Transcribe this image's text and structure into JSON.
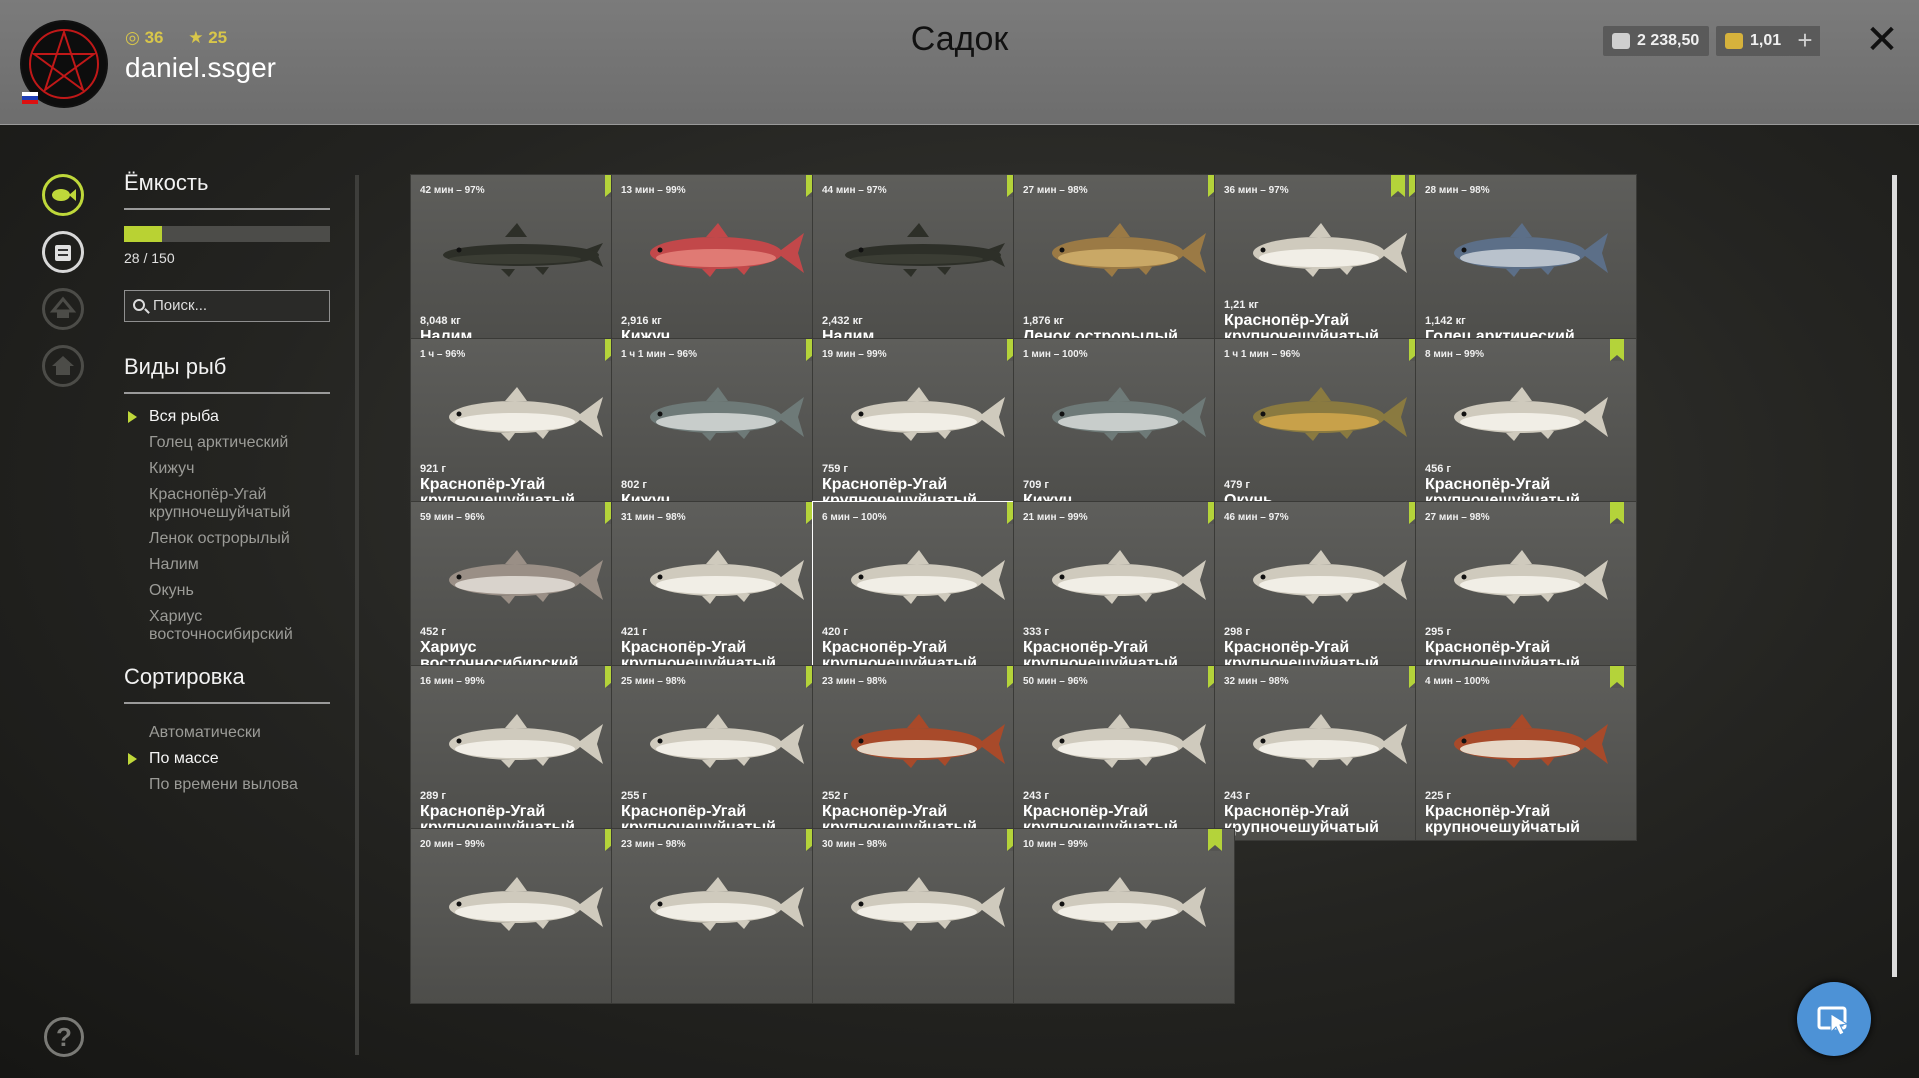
{
  "header": {
    "title": "Садок",
    "username": "daniel.ssger",
    "level": "36",
    "rank": "25",
    "silver": "2 238,50",
    "gold": "1,01",
    "add_label": "+",
    "close_label": "✕"
  },
  "capacity": {
    "title": "Ёмкость",
    "count": "28 / 150",
    "fill_fraction": 0.1867
  },
  "search": {
    "placeholder": "Поиск..."
  },
  "species": {
    "title": "Виды рыб",
    "items": [
      {
        "label": "Вся рыба",
        "selected": true
      },
      {
        "label": "Голец арктический"
      },
      {
        "label": "Кижуч"
      },
      {
        "label": "Краснопёр-Угай крупночешуйчатый"
      },
      {
        "label": "Ленок острорылый"
      },
      {
        "label": "Налим"
      },
      {
        "label": "Окунь"
      },
      {
        "label": "Хариус восточносибирский"
      }
    ]
  },
  "sorting": {
    "title": "Сортировка",
    "items": [
      {
        "label": "Автоматически"
      },
      {
        "label": "По массе",
        "selected": true
      },
      {
        "label": "По времени вылова"
      }
    ]
  },
  "help_label": "?",
  "fish": [
    {
      "time": "42 мин – 97%",
      "weight": "8,048 кг",
      "name": "Налим",
      "kind": "burbot",
      "tags": 1
    },
    {
      "time": "13 мин – 99%",
      "weight": "2,916 кг",
      "name": "Кижуч",
      "kind": "coho_red",
      "tags": 1
    },
    {
      "time": "44 мин – 97%",
      "weight": "2,432 кг",
      "name": "Налим",
      "kind": "burbot",
      "tags": 1
    },
    {
      "time": "27 мин – 98%",
      "weight": "1,876 кг",
      "name": "Ленок острорылый",
      "kind": "lenok",
      "tags": 1
    },
    {
      "time": "36 мин – 97%",
      "weight": "1,21 кг",
      "name": "Краснопёр-Угай крупночешуйчатый",
      "kind": "ugai",
      "tags": 2
    },
    {
      "time": "28 мин – 98%",
      "weight": "1,142 кг",
      "name": "Голец арктический",
      "kind": "char",
      "tags": 0
    },
    {
      "time": "1 ч – 96%",
      "weight": "921 г",
      "name": "Краснопёр-Угай крупночешуйчатый",
      "kind": "ugai",
      "tags": 1
    },
    {
      "time": "1 ч 1 мин – 96%",
      "weight": "802 г",
      "name": "Кижуч",
      "kind": "coho",
      "tags": 1
    },
    {
      "time": "19 мин – 99%",
      "weight": "759 г",
      "name": "Краснопёр-Угай крупночешуйчатый",
      "kind": "ugai",
      "tags": 1
    },
    {
      "time": "1 мин – 100%",
      "weight": "709 г",
      "name": "Кижуч",
      "kind": "coho",
      "tags": 0
    },
    {
      "time": "1 ч 1 мин – 96%",
      "weight": "479 г",
      "name": "Окунь",
      "kind": "perch",
      "tags": 1
    },
    {
      "time": "8 мин – 99%",
      "weight": "456 г",
      "name": "Краснопёр-Угай крупночешуйчатый",
      "kind": "ugai",
      "tags": 1
    },
    {
      "time": "59 мин – 96%",
      "weight": "452 г",
      "name": "Хариус восточносибирский",
      "kind": "grayling",
      "tags": 1
    },
    {
      "time": "31 мин – 98%",
      "weight": "421 г",
      "name": "Краснопёр-Угай крупночешуйчатый",
      "kind": "ugai",
      "tags": 1
    },
    {
      "time": "6 мин – 100%",
      "weight": "420 г",
      "name": "Краснопёр-Угай крупночешуйчатый",
      "kind": "ugai",
      "tags": 1,
      "selected": true
    },
    {
      "time": "21 мин – 99%",
      "weight": "333 г",
      "name": "Краснопёр-Угай крупночешуйчатый",
      "kind": "ugai",
      "tags": 1
    },
    {
      "time": "46 мин – 97%",
      "weight": "298 г",
      "name": "Краснопёр-Угай крупночешуйчатый",
      "kind": "ugai",
      "tags": 1
    },
    {
      "time": "27 мин – 98%",
      "weight": "295 г",
      "name": "Краснопёр-Угай крупночешуйчатый",
      "kind": "ugai",
      "tags": 1
    },
    {
      "time": "16 мин – 99%",
      "weight": "289 г",
      "name": "Краснопёр-Угай крупночешуйчатый",
      "kind": "ugai",
      "tags": 1
    },
    {
      "time": "25 мин – 98%",
      "weight": "255 г",
      "name": "Краснопёр-Угай крупночешуйчатый",
      "kind": "ugai",
      "tags": 1
    },
    {
      "time": "23 мин – 98%",
      "weight": "252 г",
      "name": "Краснопёр-Угай крупночешуйчатый",
      "kind": "ugai_red",
      "tags": 1
    },
    {
      "time": "50 мин – 96%",
      "weight": "243 г",
      "name": "Краснопёр-Угай крупночешуйчатый",
      "kind": "ugai",
      "tags": 1
    },
    {
      "time": "32 мин – 98%",
      "weight": "243 г",
      "name": "Краснопёр-Угай крупночешуйчатый",
      "kind": "ugai",
      "tags": 1
    },
    {
      "time": "4 мин – 100%",
      "weight": "225 г",
      "name": "Краснопёр-Угай крупночешуйчатый",
      "kind": "ugai_red",
      "tags": 1
    },
    {
      "time": "20 мин – 99%",
      "weight": "",
      "name": "",
      "kind": "ugai",
      "tags": 1
    },
    {
      "time": "23 мин – 98%",
      "weight": "",
      "name": "",
      "kind": "ugai",
      "tags": 1
    },
    {
      "time": "30 мин – 98%",
      "weight": "",
      "name": "",
      "kind": "ugai",
      "tags": 1
    },
    {
      "time": "10 мин – 99%",
      "weight": "",
      "name": "",
      "kind": "ugai",
      "tags": 1
    }
  ],
  "colors": {
    "accent": "#b4d33a",
    "fish_colors": {
      "burbot": [
        "#2d2f28",
        "#45483c"
      ],
      "coho_red": [
        "#c2484a",
        "#e07a74"
      ],
      "coho": [
        "#6e7a78",
        "#c8cdcb"
      ],
      "lenok": [
        "#9b7a45",
        "#c9a866"
      ],
      "ugai": [
        "#cfcabd",
        "#f1eee6"
      ],
      "ugai_red": [
        "#a84a2a",
        "#e6d7c6"
      ],
      "char": [
        "#5c6f88",
        "#b9c2cc"
      ],
      "perch": [
        "#8a7a40",
        "#c8a14a"
      ],
      "grayling": [
        "#9a8f86",
        "#d9d3cc"
      ]
    }
  }
}
